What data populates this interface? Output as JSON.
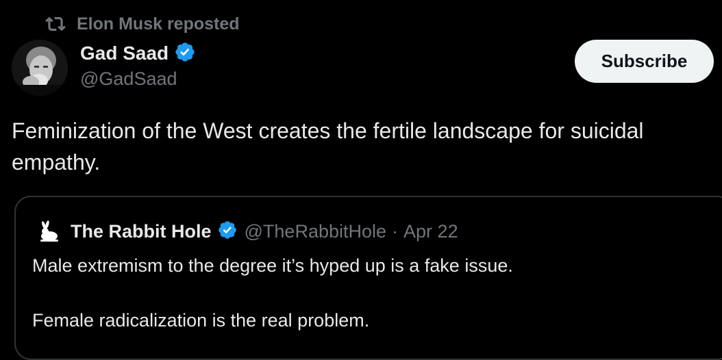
{
  "repost": {
    "text": "Elon Musk reposted",
    "icon": "repost-icon"
  },
  "author": {
    "name": "Gad Saad",
    "handle": "@GadSaad",
    "verified_icon": "verified-badge-icon",
    "verified_color": "#1d9bf0"
  },
  "subscribe": {
    "label": "Subscribe"
  },
  "tweet": {
    "text": "Feminization of the West creates the fertile landscape for suicidal empathy."
  },
  "quote": {
    "name": "The Rabbit Hole",
    "handle": "@TheRabbitHole",
    "separator": "·",
    "date": "Apr 22",
    "avatar_icon": "rabbit-icon",
    "lines": [
      "Male extremism to the degree it’s hyped up is a fake issue.",
      "Female radicalization is the real problem."
    ]
  },
  "colors": {
    "background": "#000000",
    "text_primary": "#e7e9ea",
    "text_secondary": "#71767b",
    "border": "#2f3336",
    "button_bg": "#eff3f4",
    "button_text": "#0f1419",
    "accent": "#1d9bf0"
  }
}
